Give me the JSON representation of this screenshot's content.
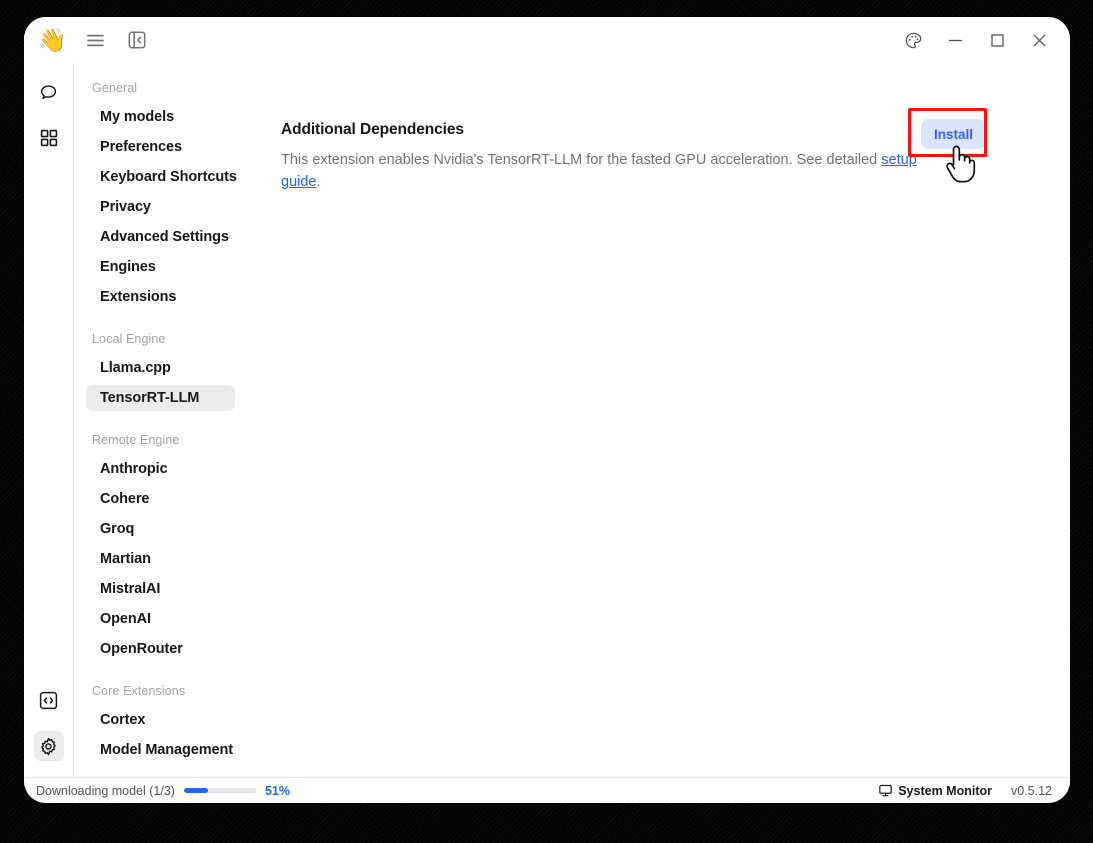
{
  "window": {
    "titlebar": {
      "logo_icon": "waving-hand-logo",
      "hamburger_icon": "hamburger-menu-icon",
      "panel_toggle_icon": "collapse-left-panel-icon",
      "theme_icon": "palette-theme-icon",
      "minimize_icon": "minimize-icon",
      "maximize_icon": "maximize-icon",
      "close_icon": "close-icon"
    }
  },
  "rail": {
    "items": [
      {
        "name": "chat",
        "icon": "chat-bubble-icon",
        "active": false
      },
      {
        "name": "hub",
        "icon": "grid-apps-icon",
        "active": false
      }
    ],
    "bottom_items": [
      {
        "name": "developer",
        "icon": "code-brackets-icon",
        "active": false
      },
      {
        "name": "settings",
        "icon": "gear-settings-icon",
        "active": true
      }
    ]
  },
  "sidebar": {
    "groups": [
      {
        "heading": "General",
        "items": [
          {
            "label": "My models",
            "selected": false
          },
          {
            "label": "Preferences",
            "selected": false
          },
          {
            "label": "Keyboard Shortcuts",
            "selected": false
          },
          {
            "label": "Privacy",
            "selected": false
          },
          {
            "label": "Advanced Settings",
            "selected": false
          },
          {
            "label": "Engines",
            "selected": false
          },
          {
            "label": "Extensions",
            "selected": false
          }
        ]
      },
      {
        "heading": "Local Engine",
        "items": [
          {
            "label": "Llama.cpp",
            "selected": false
          },
          {
            "label": "TensorRT-LLM",
            "selected": true
          }
        ]
      },
      {
        "heading": "Remote Engine",
        "items": [
          {
            "label": "Anthropic",
            "selected": false
          },
          {
            "label": "Cohere",
            "selected": false
          },
          {
            "label": "Groq",
            "selected": false
          },
          {
            "label": "Martian",
            "selected": false
          },
          {
            "label": "MistralAI",
            "selected": false
          },
          {
            "label": "OpenAI",
            "selected": false
          },
          {
            "label": "OpenRouter",
            "selected": false
          }
        ]
      },
      {
        "heading": "Core Extensions",
        "items": [
          {
            "label": "Cortex",
            "selected": false
          },
          {
            "label": "Model Management",
            "selected": false
          }
        ]
      }
    ]
  },
  "main": {
    "title": "Additional Dependencies",
    "description_before_link": "This extension enables Nvidia's TensorRT-LLM for the fasted GPU acceleration. See detailed ",
    "link_text": "setup guide",
    "description_after_link": ".",
    "install_label": "Install",
    "highlight_color": "#ff1010",
    "install_bg": "#dbe4fd",
    "install_fg": "#3b63e8",
    "cursor_icon": "pointing-hand-cursor"
  },
  "statusbar": {
    "download_text": "Downloading model (1/3)",
    "progress_percent_label": "51%",
    "progress_fill_ratio": 34,
    "system_monitor_label": "System Monitor",
    "system_monitor_icon": "monitor-display-icon",
    "version": "v0.5.12",
    "accent": "#2563eb"
  }
}
